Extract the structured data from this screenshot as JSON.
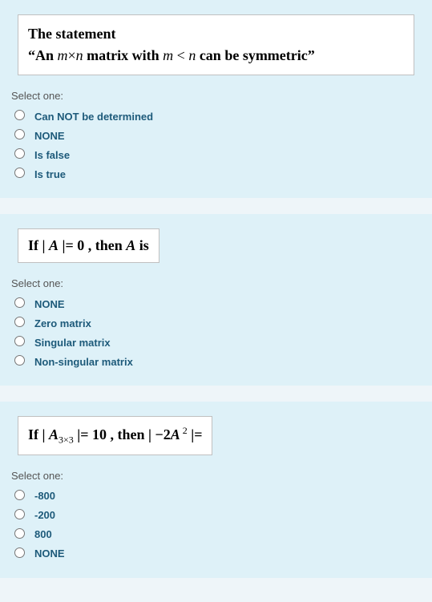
{
  "questions": [
    {
      "prompt_template": "q1",
      "select_label": "Select one:",
      "options": [
        "Can NOT be determined",
        "NONE",
        "Is false",
        "Is true"
      ]
    },
    {
      "prompt_template": "q2",
      "select_label": "Select one:",
      "options": [
        "NONE",
        "Zero matrix",
        "Singular matrix",
        "Non-singular matrix"
      ]
    },
    {
      "prompt_template": "q3",
      "select_label": "Select one:",
      "options": [
        "-800",
        "-200",
        "800",
        "NONE"
      ]
    }
  ],
  "prompts": {
    "q1": {
      "line1": "The statement",
      "line2_pre": "“An ",
      "m": "m",
      "times": "×",
      "n": "n",
      "mid": " matrix with ",
      "lt": " < ",
      "post": " can be symmetric”"
    },
    "q2": {
      "pre": "If | ",
      "A": "A",
      "mid": " |= 0 , then ",
      "post": " is"
    },
    "q3": {
      "pre": "If | ",
      "A": "A",
      "sub": "3×3",
      "mid1": " |= 10 , then  | −2",
      "A2": "A",
      "sup": " 2",
      "post": " |="
    }
  }
}
